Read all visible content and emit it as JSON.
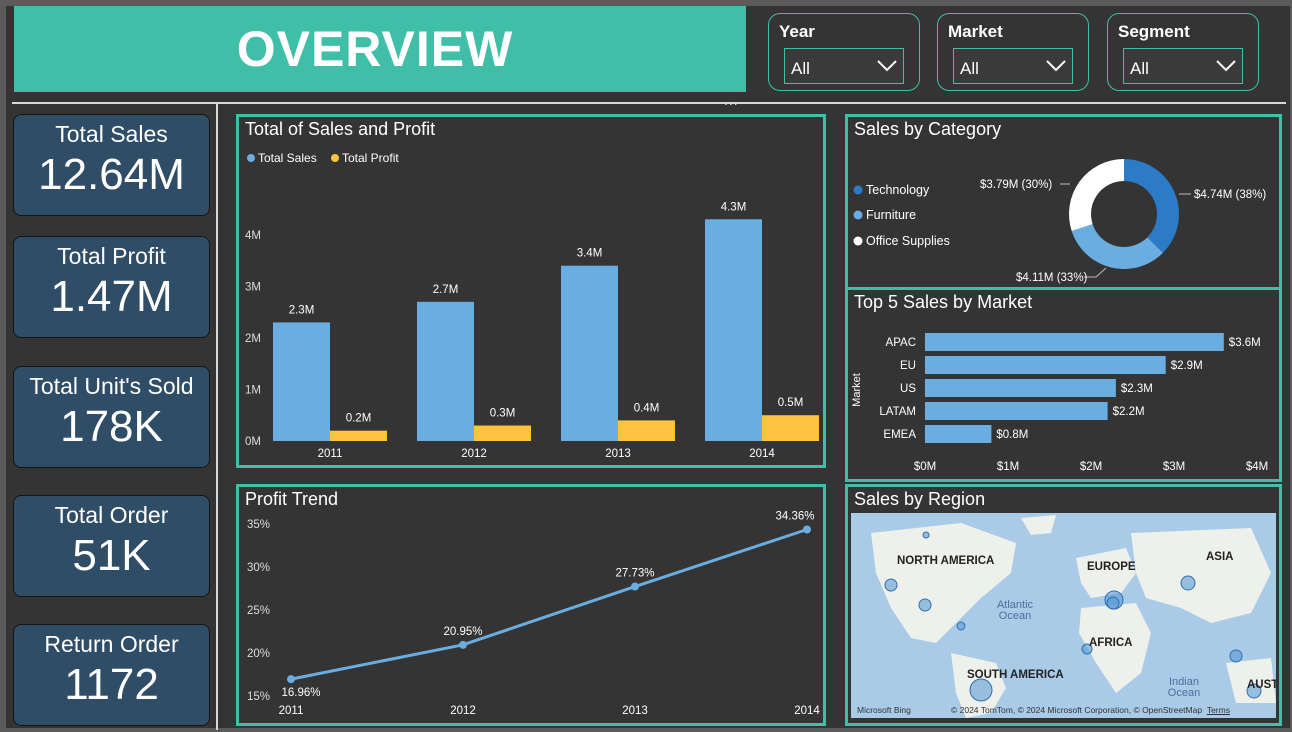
{
  "header": {
    "title": "OVERVIEW"
  },
  "slicers": [
    {
      "label": "Year",
      "value": "All"
    },
    {
      "label": "Market",
      "value": "All"
    },
    {
      "label": "Segment",
      "value": "All"
    }
  ],
  "kpis": [
    {
      "label": "Total Sales",
      "value": "12.64M"
    },
    {
      "label": "Total Profit",
      "value": "1.47M"
    },
    {
      "label": "Total Unit's Sold",
      "value": "178K"
    },
    {
      "label": "Total Order",
      "value": "51K"
    },
    {
      "label": "Return Order",
      "value": "1172"
    }
  ],
  "colors": {
    "accent": "#3fbfa7",
    "kpi_bg": "#2f4d66",
    "sales": "#6aade0",
    "profit": "#fec33f",
    "tech": "#2b7bc7",
    "furniture": "#6aade0",
    "office": "#ffffff"
  },
  "more_icon": "...",
  "chart_data": [
    {
      "type": "bar",
      "title": "Total of Sales and Profit",
      "categories": [
        "2011",
        "2012",
        "2013",
        "2014"
      ],
      "series": [
        {
          "name": "Total Sales",
          "values": [
            2.3,
            2.7,
            3.4,
            4.3
          ],
          "labels": [
            "2.3M",
            "2.7M",
            "3.4M",
            "4.3M"
          ]
        },
        {
          "name": "Total Profit",
          "values": [
            0.2,
            0.3,
            0.4,
            0.5
          ],
          "labels": [
            "0.2M",
            "0.3M",
            "0.4M",
            "0.5M"
          ]
        }
      ],
      "yticks": [
        "0M",
        "1M",
        "2M",
        "3M",
        "4M"
      ],
      "ylim": [
        0,
        4.5
      ]
    },
    {
      "type": "line",
      "title": "Profit Trend",
      "x": [
        "2011",
        "2012",
        "2013",
        "2014"
      ],
      "values": [
        16.96,
        20.95,
        27.73,
        34.36
      ],
      "labels": [
        "16.96%",
        "20.95%",
        "27.73%",
        "34.36%"
      ],
      "yticks": [
        "15%",
        "20%",
        "25%",
        "30%",
        "35%"
      ],
      "ylim": [
        15,
        35
      ]
    },
    {
      "type": "pie",
      "title": "Sales by Category",
      "legend": [
        "Technology",
        "Furniture",
        "Office Supplies"
      ],
      "values": [
        4.74,
        4.11,
        3.79
      ],
      "labels": [
        "$4.74M (38%)",
        "$4.11M (33%)",
        "$3.79M (30%)"
      ]
    },
    {
      "type": "bar",
      "title": "Top 5 Sales by Market",
      "ylabel": "Market",
      "categories": [
        "APAC",
        "EU",
        "US",
        "LATAM",
        "EMEA"
      ],
      "values": [
        3.6,
        2.9,
        2.3,
        2.2,
        0.8
      ],
      "labels": [
        "$3.6M",
        "$2.9M",
        "$2.3M",
        "$2.2M",
        "$0.8M"
      ],
      "xticks": [
        "$0M",
        "$1M",
        "$2M",
        "$3M",
        "$4M"
      ],
      "xlim": [
        0,
        4
      ]
    }
  ],
  "map": {
    "title": "Sales by Region",
    "regions": [
      "NORTH AMERICA",
      "EUROPE",
      "ASIA",
      "AFRICA",
      "SOUTH AMERICA",
      "AUST"
    ],
    "oceans": [
      "Atlantic Ocean",
      "Indian Ocean"
    ],
    "brand": "Microsoft Bing",
    "copyright": "© 2024 TomTom, © 2024 Microsoft Corporation, © OpenStreetMap",
    "terms": "Terms"
  }
}
